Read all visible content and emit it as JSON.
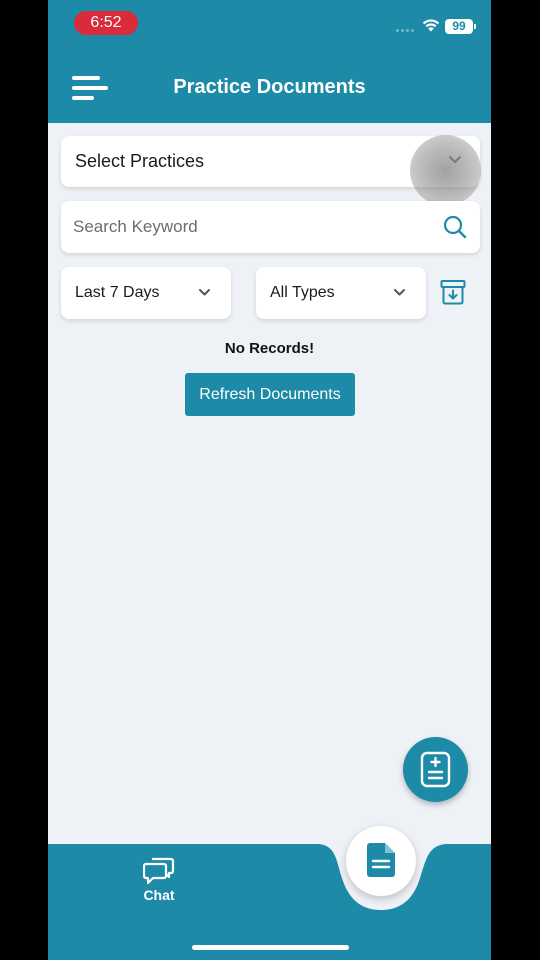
{
  "status_bar": {
    "time": "6:52",
    "battery": "99"
  },
  "header": {
    "title": "Practice Documents",
    "menu_icon": "menu-icon"
  },
  "filters": {
    "practices_label": "Select Practices",
    "search_placeholder": "Search Keyword",
    "date_range": "Last 7 Days",
    "doc_type": "All Types"
  },
  "content": {
    "empty_message": "No Records!",
    "refresh_label": "Refresh Documents"
  },
  "bottom_nav": {
    "chat_label": "Chat"
  },
  "colors": {
    "primary": "#1d8aa8",
    "background": "#eef1f6",
    "time_pill": "#d92b3a"
  }
}
